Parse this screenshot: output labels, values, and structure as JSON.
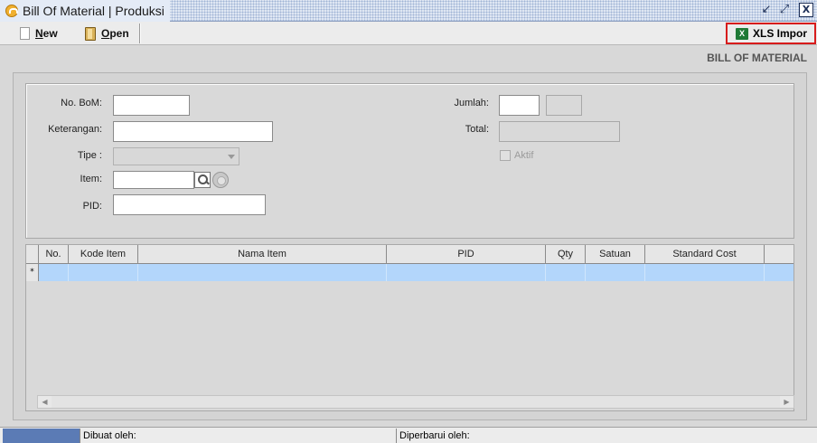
{
  "window": {
    "title": "Bill Of Material | Produksi",
    "icon": "app-icon",
    "controls": {
      "restore": "↙",
      "maximize": "⤢",
      "close": "X"
    }
  },
  "toolbar": {
    "new_label": "New",
    "open_label": "Open",
    "xls_import_label": "XLS Impor",
    "xls_icon_glyph": "X"
  },
  "section_title": "BILL OF MATERIAL",
  "form": {
    "no_bom_label": "No. BoM:",
    "no_bom_value": "",
    "keterangan_label": "Keterangan:",
    "keterangan_value": "",
    "tipe_label": "Tipe :",
    "tipe_value": "",
    "item_label": "Item:",
    "item_value": "",
    "pid_label": "PID:",
    "pid_value": "",
    "jumlah_label": "Jumlah:",
    "jumlah_value": "",
    "jumlah_unit": "",
    "total_label": "Total:",
    "total_value": "",
    "aktif_label": "Aktif"
  },
  "grid": {
    "columns": [
      "No.",
      "Kode Item",
      "Nama Item",
      "PID",
      "Qty",
      "Satuan",
      "Standard Cost"
    ],
    "new_row_marker": "*",
    "rows": []
  },
  "statusbar": {
    "created_by": "Dibuat oleh:",
    "updated_by": "Diperbarui oleh:"
  },
  "colors": {
    "highlight_border": "#d71c1c",
    "selected_row": "#b3d6fb",
    "status_block": "#5b7bb5"
  }
}
